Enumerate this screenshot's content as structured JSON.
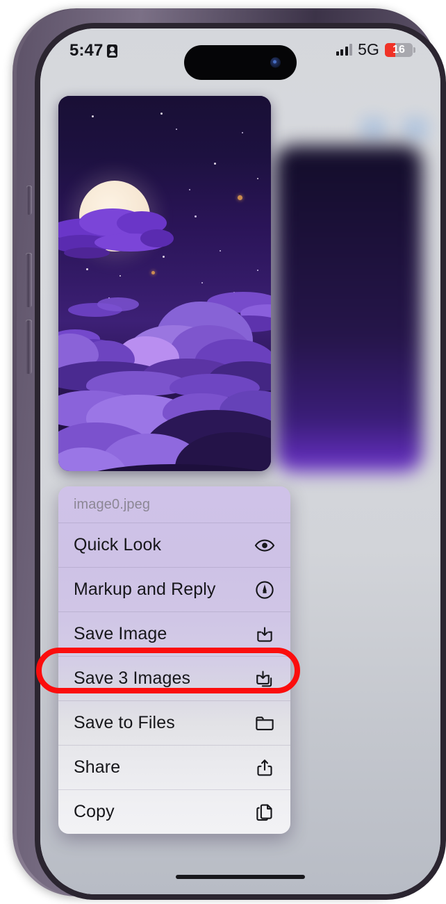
{
  "device": {
    "name": "iPhone 14 Pro",
    "buttons": [
      "mute-switch",
      "volume-up",
      "volume-down",
      "power"
    ]
  },
  "status_bar": {
    "time": "5:47",
    "location_icon": "location-arrow-icon",
    "signal_icon": "cellular-bars-icon",
    "network": "5G",
    "battery_percent": "16",
    "battery_color": "#f03227"
  },
  "preview": {
    "alt": "night sky wallpaper with moon and purple clouds",
    "moon_color": "#f6e7d3",
    "sky_color": "#2a1457",
    "cloud_color": "#7d4fd6"
  },
  "context_menu": {
    "header": "image0.jpeg",
    "items": [
      {
        "label": "Quick Look",
        "icon": "eye-icon"
      },
      {
        "label": "Markup and Reply",
        "icon": "markup-pen-icon"
      },
      {
        "label": "Save Image",
        "icon": "save-download-icon"
      },
      {
        "label": "Save 3 Images",
        "icon": "save-multiple-icon",
        "highlighted": true
      },
      {
        "label": "Save to Files",
        "icon": "folder-icon"
      },
      {
        "label": "Share",
        "icon": "share-icon"
      },
      {
        "label": "Copy",
        "icon": "copy-icon"
      }
    ]
  },
  "annotation": {
    "type": "red-rounded-rect-highlight",
    "target": "Save 3 Images",
    "color": "#fb0d0d"
  }
}
